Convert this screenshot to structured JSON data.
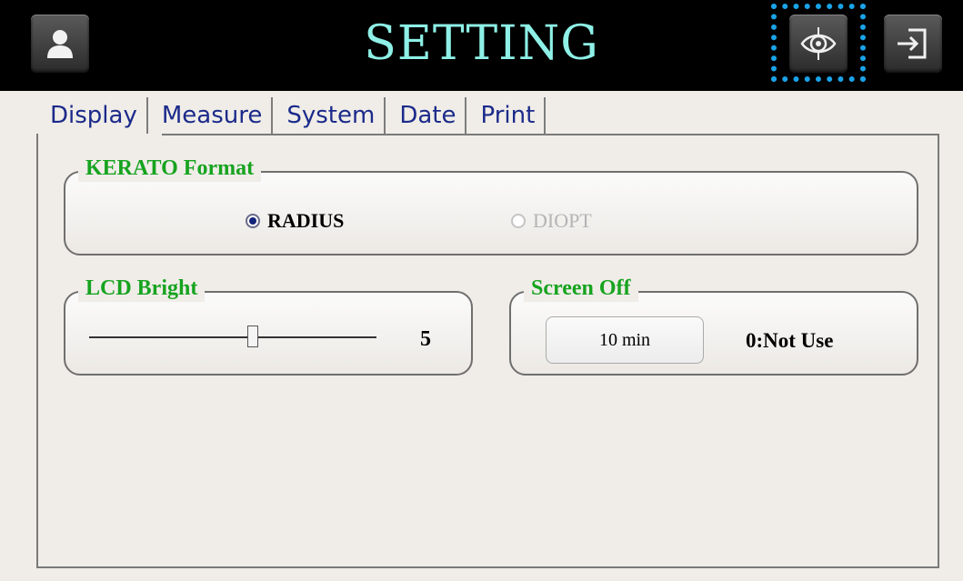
{
  "header": {
    "title": "SETTING",
    "icons": {
      "user": "user-icon",
      "eye": "eye-target-icon",
      "exit": "exit-icon"
    },
    "highlight_color": "#1aa3e8"
  },
  "tabs": [
    {
      "label": "Display",
      "active": true
    },
    {
      "label": "Measure"
    },
    {
      "label": "System"
    },
    {
      "label": "Date"
    },
    {
      "label": "Print"
    }
  ],
  "kerato": {
    "title": "KERATO Format",
    "options": [
      {
        "label": "RADIUS",
        "selected": true
      },
      {
        "label": "DIOPT",
        "selected": false
      }
    ]
  },
  "lcd": {
    "title": "LCD Bright",
    "value": "5"
  },
  "screen_off": {
    "title": "Screen Off",
    "value": "10 min",
    "note": "0:Not Use"
  },
  "colors": {
    "accent": "#17a31f",
    "title": "#8ef0e6",
    "tab_text": "#1b2a8a"
  }
}
